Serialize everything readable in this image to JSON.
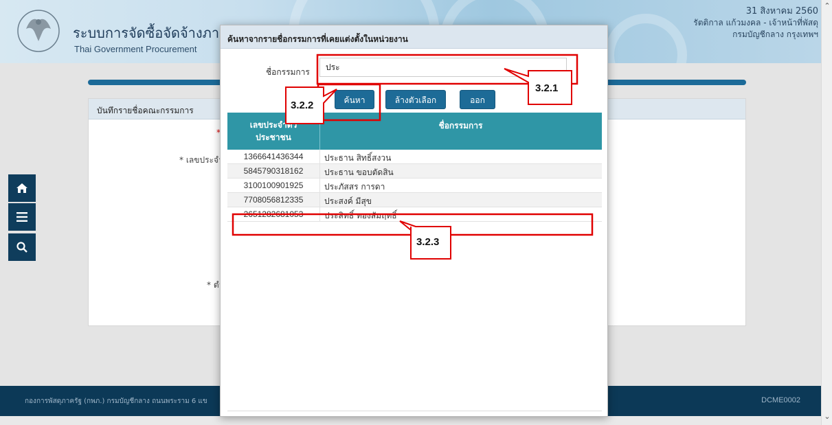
{
  "header": {
    "title": "ระบบการจัดซื้อจัดจ้างภาค",
    "subtitle": "Thai Government Procurement",
    "date": "31 สิงหาคม 2560",
    "user": "รัตติกาล แก้วมงคล - เจ้าหน้าที่พัสดุ",
    "org": "กรมบัญชีกลาง กรุงเทพฯ"
  },
  "panel": {
    "title": "บันทึกรายชื่อคณะกรรมการ",
    "labels": {
      "required_mark": "*",
      "id_label": "* เลขประจำ",
      "position_label": "* ตำ"
    }
  },
  "left_nav": {
    "icons": [
      "home-icon",
      "menu-icon",
      "search-icon"
    ]
  },
  "footer": {
    "text": "กองการพัสดุภาครัฐ (กพภ.) กรมบัญชีกลาง ถนนพระราม 6 แข",
    "code": "DCME0002"
  },
  "modal": {
    "title": "ค้นหาจากรายชื่อกรรมการที่เคยแต่งตั้งในหน่วยงาน",
    "field_label": "ชื่อกรรมการ",
    "field_value": "ประ",
    "buttons": {
      "search": "ค้นหา",
      "clear": "ล้างตัวเลือก",
      "exit": "ออก"
    },
    "table": {
      "col_id_line1": "เลขประจำตัว",
      "col_id_line2": "ประชาชน",
      "col_name": "ชื่อกรรมการ",
      "rows": [
        {
          "id": "1366641436344",
          "name": "ประธาน สิทธิ์สงวน"
        },
        {
          "id": "5845790318162",
          "name": "ประธาน ขอบตัดสิน"
        },
        {
          "id": "3100100901925",
          "name": "ประภัสสร การดา"
        },
        {
          "id": "7708056812335",
          "name": "ประสงค์ มีสุข"
        },
        {
          "id": "2651282681053",
          "name": "ประสิทธิ์ ทองสัมฤทธิ์"
        }
      ]
    }
  },
  "annotations": {
    "a1": "3.2.1",
    "a2": "3.2.2",
    "a3": "3.2.3"
  },
  "colors": {
    "nav_dark": "#0f3d5c",
    "button_blue": "#1d6b97",
    "table_header": "#2f96a6",
    "annotation_red": "#e00000"
  }
}
